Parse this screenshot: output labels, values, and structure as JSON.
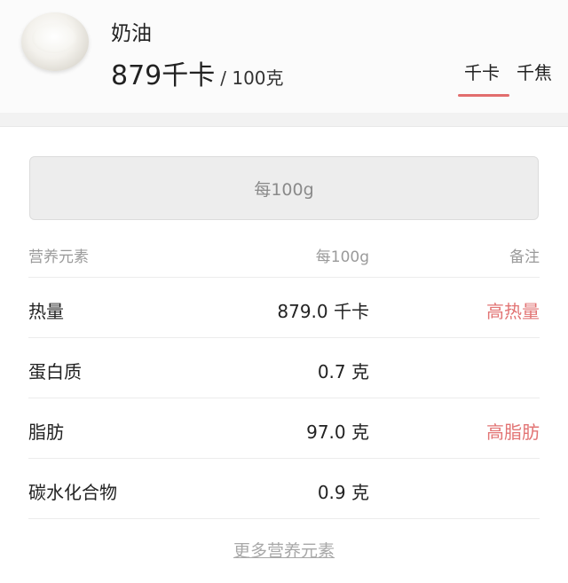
{
  "food": {
    "name": "奶油",
    "calories": "879千卡",
    "per": "/ 100克"
  },
  "units": {
    "kcal": "千卡",
    "kj": "千焦",
    "active": "kcal"
  },
  "basis_button": "每100g",
  "table": {
    "headers": [
      "营养元素",
      "每100g",
      "备注"
    ],
    "rows": [
      {
        "nutrient": "热量",
        "value": "879.0 千卡",
        "note": "高热量"
      },
      {
        "nutrient": "蛋白质",
        "value": "0.7 克",
        "note": ""
      },
      {
        "nutrient": "脂肪",
        "value": "97.0 克",
        "note": "高脂肪"
      },
      {
        "nutrient": "碳水化合物",
        "value": "0.9 克",
        "note": ""
      }
    ]
  },
  "more_link": "更多营养元素",
  "colors": {
    "accent": "#e26d6d",
    "warning_text": "#e27474"
  }
}
